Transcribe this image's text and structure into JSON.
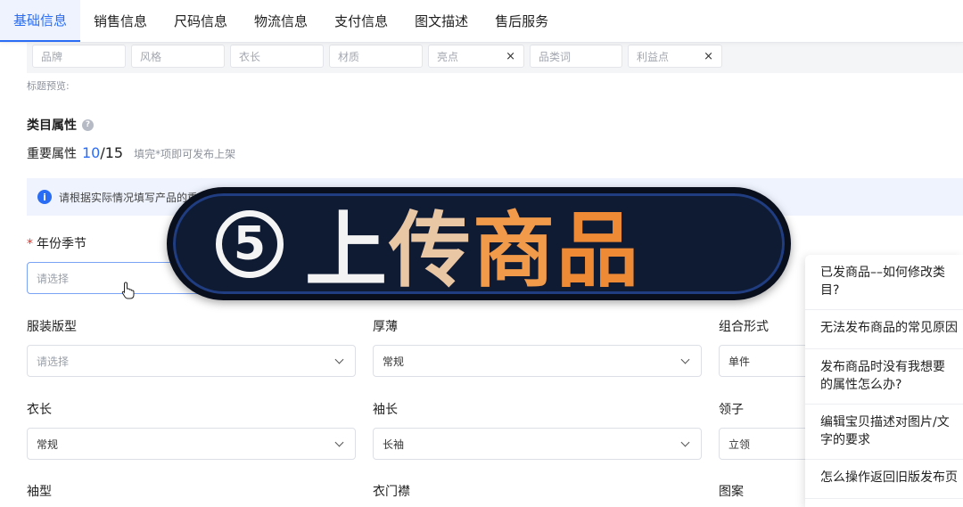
{
  "tabs": [
    {
      "label": "基础信息",
      "active": true
    },
    {
      "label": "销售信息"
    },
    {
      "label": "尺码信息"
    },
    {
      "label": "物流信息"
    },
    {
      "label": "支付信息"
    },
    {
      "label": "图文描述"
    },
    {
      "label": "售后服务"
    }
  ],
  "title_fields": [
    {
      "placeholder": "品牌"
    },
    {
      "placeholder": "风格"
    },
    {
      "placeholder": "衣长"
    },
    {
      "placeholder": "材质"
    },
    {
      "placeholder": "亮点",
      "clear": "×"
    },
    {
      "placeholder": "品类词"
    },
    {
      "placeholder": "利益点",
      "clear": "×"
    }
  ],
  "title_preview_label": "标题预览:",
  "category_section": {
    "title": "类目属性",
    "help_icon": "?",
    "important_label": "重要属性",
    "important_done": "10",
    "important_total": "/15",
    "important_hint": "填完*项即可发布上架"
  },
  "info_banner": {
    "icon": "i",
    "text": "请根据实际情况填写产品的重"
  },
  "fields": {
    "year_season": {
      "required_mark": "*",
      "label": "年份季节",
      "placeholder": "请选择"
    },
    "clothing_fit": {
      "label": "服装版型",
      "placeholder": "请选择"
    },
    "thickness": {
      "label": "厚薄",
      "value": "常规"
    },
    "combination": {
      "label": "组合形式",
      "value": "单件"
    },
    "garment_length": {
      "label": "衣长",
      "value": "常规"
    },
    "sleeve_length": {
      "label": "袖长",
      "value": "长袖"
    },
    "collar": {
      "label": "领子",
      "value": "立领"
    },
    "sleeve_type": {
      "label": "袖型"
    },
    "placket": {
      "label": "衣门襟"
    },
    "pattern": {
      "label": "图案"
    }
  },
  "overlay": {
    "number": "5",
    "chars": [
      "上",
      "传",
      "商",
      "品"
    ]
  },
  "help_panel": {
    "items": [
      "已发商品––如何修改类目?",
      "无法发布商品的常见原因",
      "发布商品时没有我想要的属性怎么办?",
      "编辑宝贝描述对图片/文字的要求",
      "怎么操作返回旧版发布页"
    ]
  }
}
